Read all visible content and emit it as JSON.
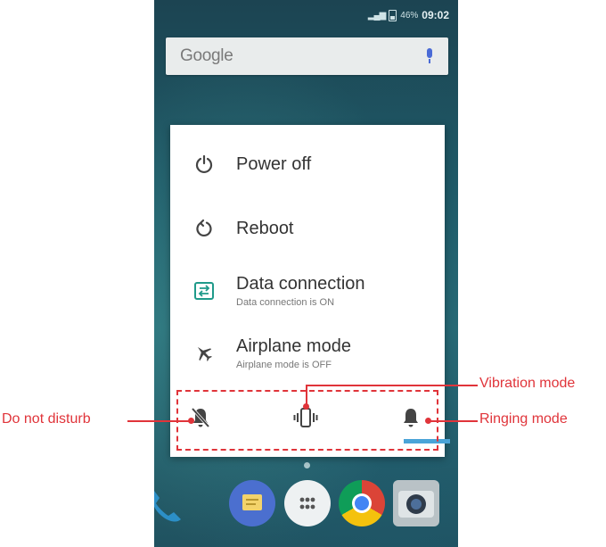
{
  "status_bar": {
    "signal": "⁴ᴳ",
    "battery": "46%",
    "time": "09:02"
  },
  "search": {
    "logo": "Google"
  },
  "power_menu": {
    "items": [
      {
        "title": "Power off",
        "subtitle": "",
        "icon": "power-icon"
      },
      {
        "title": "Reboot",
        "subtitle": "",
        "icon": "reboot-icon"
      },
      {
        "title": "Data connection",
        "subtitle": "Data connection is ON",
        "icon": "data-connection-icon"
      },
      {
        "title": "Airplane mode",
        "subtitle": "Airplane mode is OFF",
        "icon": "airplane-icon"
      }
    ],
    "sound_modes": [
      {
        "icon": "bell-off-icon",
        "selected": false
      },
      {
        "icon": "vibrate-icon",
        "selected": false
      },
      {
        "icon": "bell-icon",
        "selected": true
      }
    ]
  },
  "annotations": {
    "do_not_disturb": "Do not disturb",
    "vibration_mode": "Vibration mode",
    "ringing_mode": "Ringing mode"
  },
  "colors": {
    "annotation": "#e0343a",
    "accent": "#4aa4d8",
    "data_icon": "#1f9a8a"
  }
}
